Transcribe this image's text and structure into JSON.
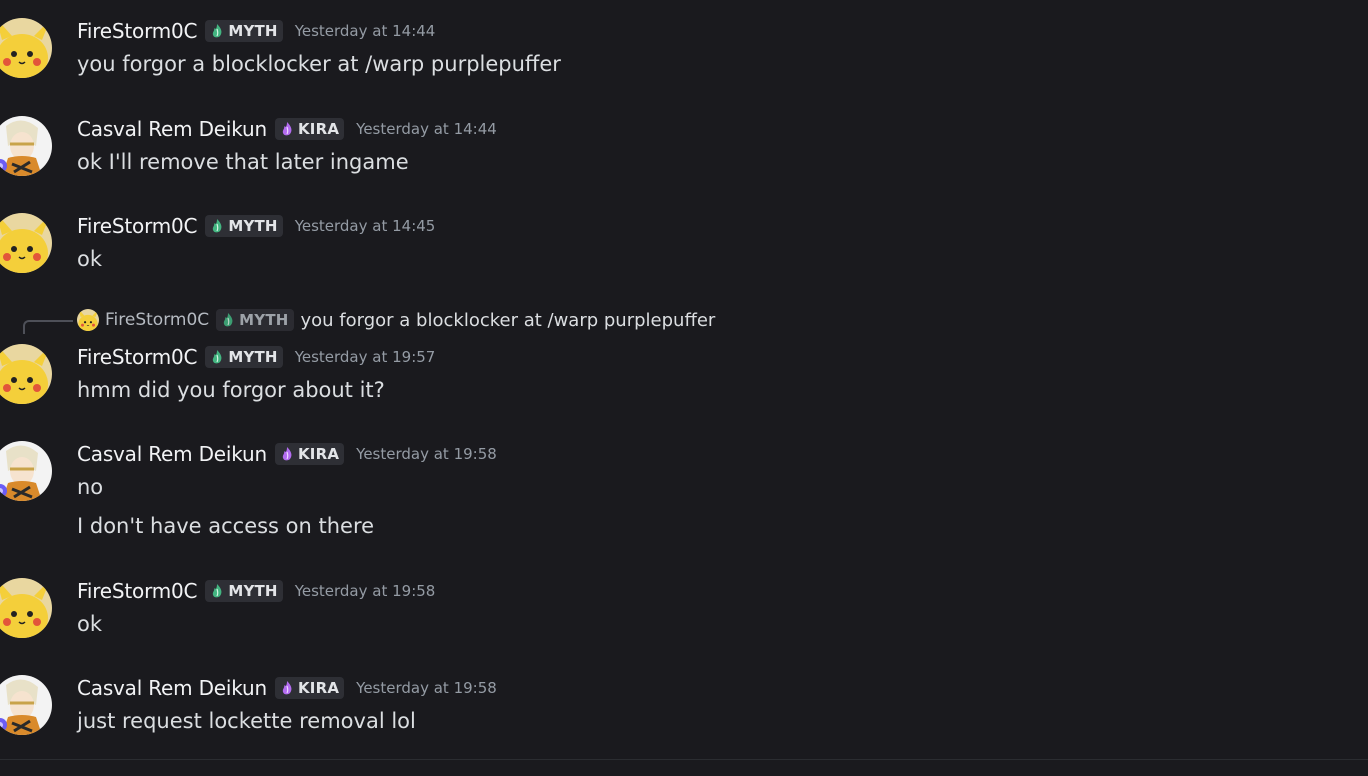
{
  "users": {
    "fire": {
      "name": "FireStorm0C",
      "tag": "MYTH",
      "tag_icon": "leaf-flame-icon",
      "tag_color": "#43b581"
    },
    "casval": {
      "name": "Casval Rem Deikun",
      "tag": "KIRA",
      "tag_icon": "purple-flame-icon",
      "tag_color": "#b36cf0"
    }
  },
  "messages": [
    {
      "user": "FireStorm0C",
      "tag": "MYTH",
      "time": "Yesterday at 14:44",
      "lines": [
        "you forgor a blocklocker at /warp purplepuffer"
      ]
    },
    {
      "user": "Casval Rem Deikun",
      "tag": "KIRA",
      "time": "Yesterday at 14:44",
      "lines": [
        "ok I'll remove that later ingame"
      ]
    },
    {
      "user": "FireStorm0C",
      "tag": "MYTH",
      "time": "Yesterday at 14:45",
      "lines": [
        "ok"
      ]
    },
    {
      "user": "FireStorm0C",
      "tag": "MYTH",
      "time": "Yesterday at 19:57",
      "lines": [
        "hmm did you forgor about it?"
      ],
      "reply": {
        "user": "FireStorm0C",
        "tag": "MYTH",
        "text": "you forgor a blocklocker at /warp purplepuffer"
      }
    },
    {
      "user": "Casval Rem Deikun",
      "tag": "KIRA",
      "time": "Yesterday at 19:58",
      "lines": [
        "no",
        "I don't have access on there"
      ]
    },
    {
      "user": "FireStorm0C",
      "tag": "MYTH",
      "time": "Yesterday at 19:58",
      "lines": [
        "ok"
      ]
    },
    {
      "user": "Casval Rem Deikun",
      "tag": "KIRA",
      "time": "Yesterday at 19:58",
      "lines": [
        "just request lockette removal lol"
      ]
    }
  ]
}
